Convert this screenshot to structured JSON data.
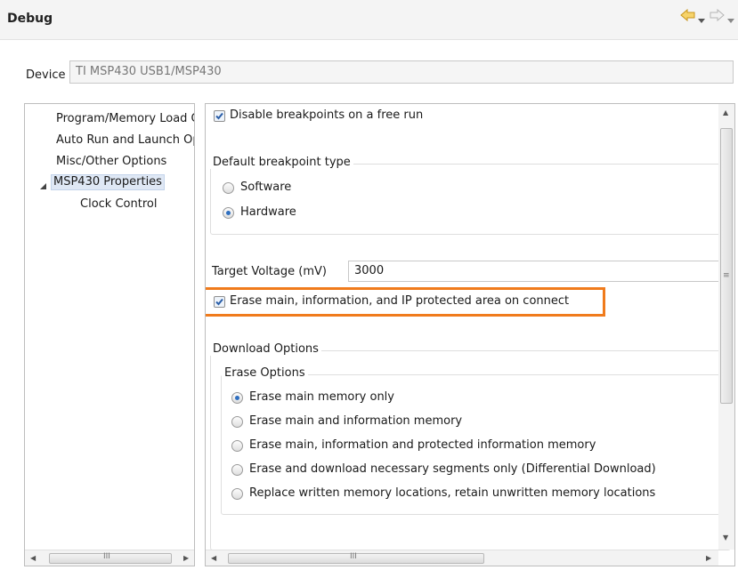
{
  "header": {
    "title": "Debug"
  },
  "device": {
    "label": "Device",
    "value": "TI MSP430 USB1/MSP430"
  },
  "tree": {
    "items": [
      {
        "label": "Program/Memory Load Options"
      },
      {
        "label": "Auto Run and Launch Options"
      },
      {
        "label": "Misc/Other Options"
      },
      {
        "label": "MSP430 Properties",
        "selected": true,
        "expanded": true
      },
      {
        "label": "Clock Control"
      }
    ]
  },
  "options": {
    "disable_breakpoints": {
      "label": "Disable breakpoints on a free run",
      "checked": true
    },
    "breakpoint_type": {
      "title": "Default breakpoint type",
      "choices": [
        {
          "label": "Software",
          "selected": false
        },
        {
          "label": "Hardware",
          "selected": true
        }
      ]
    },
    "target_voltage": {
      "label": "Target Voltage (mV)",
      "value": "3000"
    },
    "erase_on_connect": {
      "label": "Erase main, information, and IP protected area on connect",
      "checked": true
    },
    "download": {
      "title": "Download Options",
      "erase": {
        "title": "Erase Options",
        "choices": [
          {
            "label": "Erase main memory only",
            "selected": true
          },
          {
            "label": "Erase main and information memory",
            "selected": false
          },
          {
            "label": "Erase main, information and protected information memory",
            "selected": false
          },
          {
            "label": "Erase and download necessary segments only (Differential Download)",
            "selected": false
          },
          {
            "label": "Replace written memory locations, retain unwritten memory locations",
            "selected": false
          }
        ]
      }
    }
  },
  "scrollbars": {
    "left_h_glyph": "III",
    "right_h_glyph": "III",
    "right_v_glyph": "≡"
  },
  "colors": {
    "highlight": "#f07b1c",
    "nav_arrow": "#d9a520",
    "selection": "#dfe8f5"
  }
}
